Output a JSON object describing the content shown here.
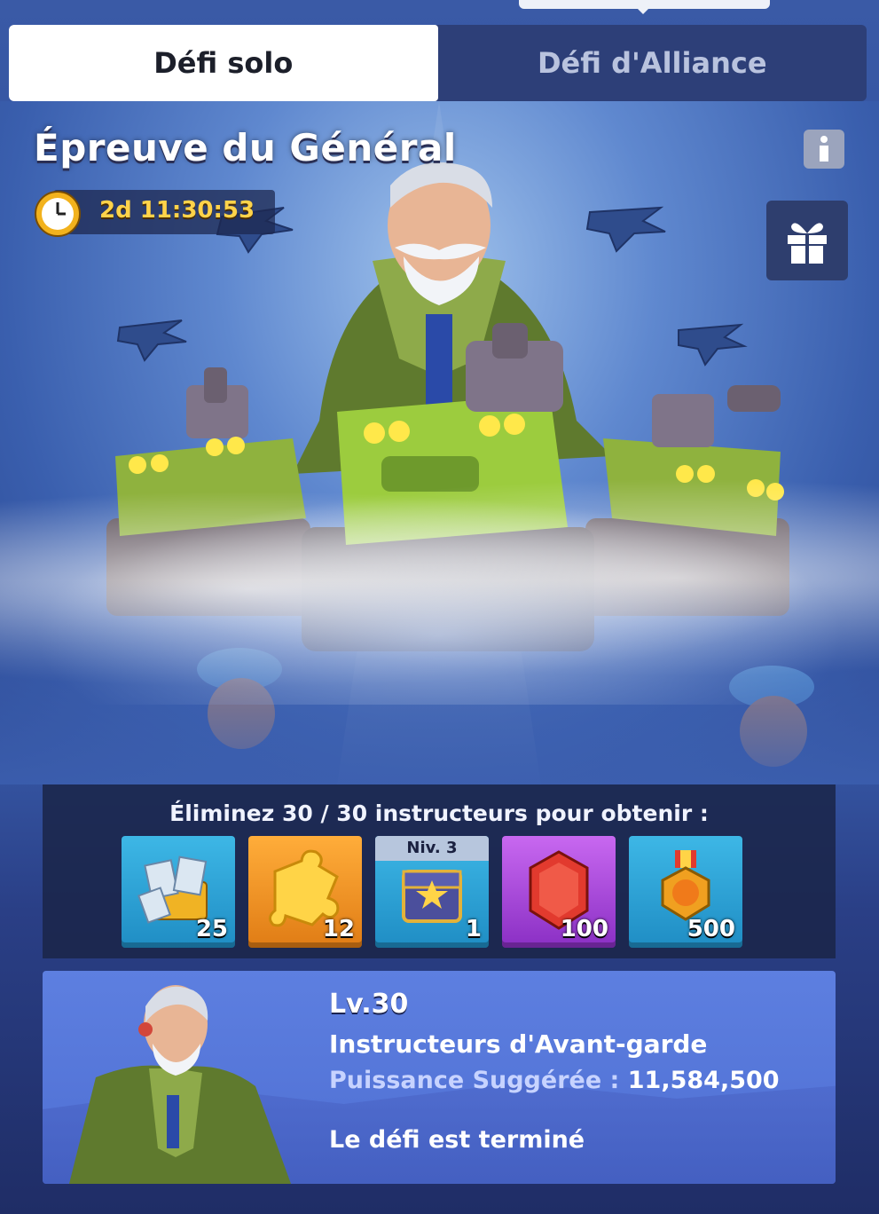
{
  "tabs": [
    {
      "label": "Défi solo",
      "active": true
    },
    {
      "label": "Défi d'Alliance",
      "active": false
    }
  ],
  "event": {
    "title": "Épreuve du Général",
    "timer": "2d 11:30:53"
  },
  "objective": {
    "text": "Éliminez 30 / 30 instructeurs pour obtenir :"
  },
  "rewards": [
    {
      "icon": "exp-crate-icon",
      "qty": "25"
    },
    {
      "icon": "puzzle-piece-icon",
      "qty": "12"
    },
    {
      "icon": "chest-icon",
      "level_label": "Niv. 3",
      "qty": "1"
    },
    {
      "icon": "red-gem-icon",
      "qty": "100"
    },
    {
      "icon": "medal-icon",
      "qty": "500"
    }
  ],
  "boss": {
    "level": "Lv.30",
    "name": "Instructeurs d'Avant-garde",
    "power_label": "Puissance Suggérée :",
    "power_value": "11,584,500",
    "status": "Le défi est terminé"
  },
  "colors": {
    "accent_gold": "#ffd34a",
    "panel_dark": "#1a2448",
    "card_blue": "#5d7fe0"
  }
}
